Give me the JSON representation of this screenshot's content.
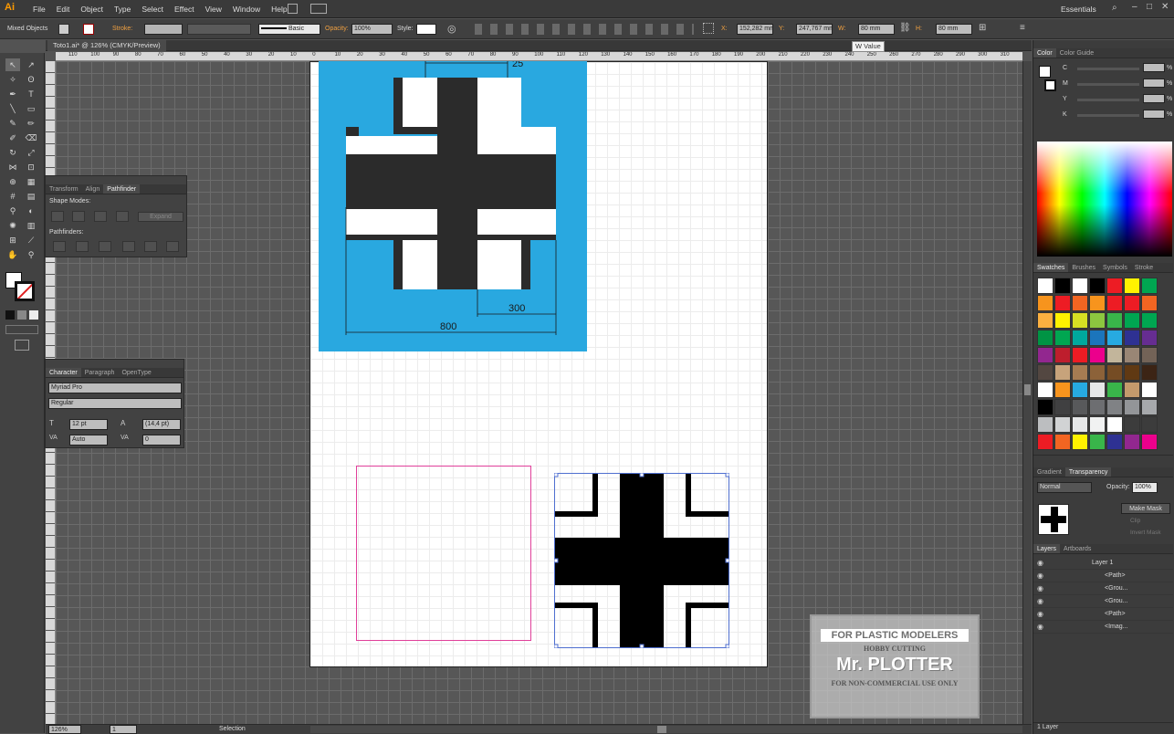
{
  "app": {
    "logo": "Ai",
    "workspace": "Essentials"
  },
  "menu": [
    "File",
    "Edit",
    "Object",
    "Type",
    "Select",
    "Effect",
    "View",
    "Window",
    "Help"
  ],
  "control": {
    "selection_label": "Mixed Objects",
    "stroke_label": "Stroke:",
    "brush_value": "Basic",
    "opacity_label": "Opacity:",
    "opacity_value": "100%",
    "style_label": "Style:",
    "x_label": "X:",
    "x_value": "152,282 mm",
    "y_label": "Y:",
    "y_value": "247,767 mm",
    "w_label": "W:",
    "w_value": "80 mm",
    "h_label": "H:",
    "h_value": "80 mm",
    "tooltip": "W Value"
  },
  "document": {
    "tab": "Toto1.ai* @ 126% (CMYK/Preview)"
  },
  "ruler_h": [
    "110",
    "100",
    "90",
    "80",
    "70",
    "60",
    "50",
    "40",
    "30",
    "20",
    "10",
    "0",
    "10",
    "20",
    "30",
    "40",
    "50",
    "60",
    "70",
    "80",
    "90",
    "100",
    "110",
    "120",
    "130",
    "140",
    "150",
    "160",
    "170",
    "180",
    "190",
    "200",
    "210",
    "220",
    "230",
    "240",
    "250",
    "260",
    "270",
    "280",
    "290",
    "300",
    "310",
    "320"
  ],
  "artwork": {
    "dim_top": "25",
    "dim_small": "300",
    "dim_large": "800"
  },
  "pathfinder": {
    "tabs": [
      "Transform",
      "Align",
      "Pathfinder"
    ],
    "shape_modes_label": "Shape Modes:",
    "expand_label": "Expand",
    "pathfinders_label": "Pathfinders:"
  },
  "character": {
    "tabs": [
      "Character",
      "Paragraph",
      "OpenType"
    ],
    "font": "Myriad Pro",
    "style": "Regular",
    "size": "12 pt",
    "leading": "(14,4 pt)",
    "kerning": "Auto",
    "tracking": "0"
  },
  "color_panel": {
    "tabs": [
      "Color",
      "Color Guide"
    ],
    "channels": [
      {
        "label": "C"
      },
      {
        "label": "M"
      },
      {
        "label": "Y"
      },
      {
        "label": "K"
      }
    ],
    "unit": "%"
  },
  "swatches_panel": {
    "tabs": [
      "Swatches",
      "Brushes",
      "Symbols",
      "Stroke"
    ],
    "colors": [
      "#ffffff",
      "#000000",
      "#ffffff",
      "#000000",
      "#ed1c24",
      "#fff200",
      "#00a651",
      "#f7941d",
      "#ed1c24",
      "#f26522",
      "#f7941d",
      "#ed1c24",
      "#ed1c24",
      "#f26522",
      "#fbb040",
      "#fff200",
      "#d7df23",
      "#8dc63f",
      "#39b54a",
      "#00a651",
      "#00a651",
      "#009444",
      "#00a651",
      "#00a99d",
      "#1b75bc",
      "#27aae1",
      "#2e3192",
      "#662d91",
      "#92278f",
      "#be1e2d",
      "#ed1c24",
      "#ec008c",
      "#c2b59b",
      "#998675",
      "#736357",
      "#534741",
      "#c7a37b",
      "#a67c52",
      "#8c6239",
      "#754c24",
      "#603913",
      "#3c2415",
      "#ffffff",
      "#f7941d",
      "#27aae1",
      "#e6e7e8",
      "#39b54a",
      "#c49a6c",
      "#ffffff",
      "#000000",
      "#404041",
      "#58595b",
      "#6d6e71",
      "#808285",
      "#939598",
      "#a7a9ac",
      "#bcbec0",
      "#d1d3d4",
      "#e6e7e8",
      "#f1f2f2",
      "#ffffff",
      "#3c3c3c",
      "#3c3c3c",
      "#ed1c24",
      "#f26522",
      "#fff200",
      "#39b54a",
      "#2e3192",
      "#92278f",
      "#ec008c"
    ]
  },
  "transparency": {
    "tabs": [
      "Gradient",
      "Transparency"
    ],
    "mode": "Normal",
    "opacity_label": "Opacity:",
    "opacity_value": "100%",
    "make_mask": "Make Mask",
    "clip": "Clip",
    "invert": "Invert Mask"
  },
  "layers": {
    "tabs": [
      "Layers",
      "Artboards"
    ],
    "items": [
      "Layer 1",
      "<Path>",
      "<Grou...",
      "<Grou...",
      "<Path>",
      "<Imag..."
    ],
    "footer": "1 Layer"
  },
  "status": {
    "zoom": "126%",
    "artboard": "1",
    "tool": "Selection"
  },
  "watermark": {
    "line1": "FOR PLASTIC MODELERS",
    "line2": "HOBBY CUTTING",
    "line3": "Mr. PLOTTER",
    "line4": "FOR NON-COMMERCIAL USE ONLY"
  }
}
